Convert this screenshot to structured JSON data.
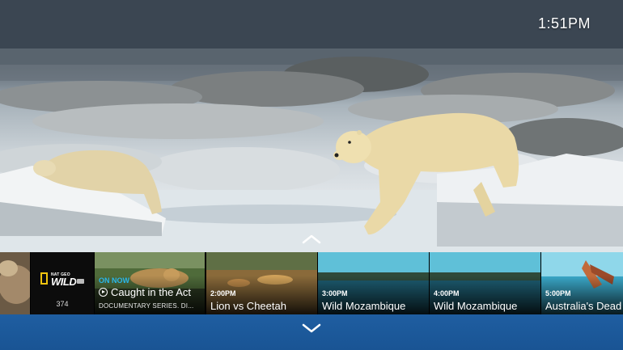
{
  "clock": "1:51PM",
  "channel": {
    "logo_top": "NAT GEO",
    "logo_main": "WILD",
    "logo_badge": "HD",
    "number": "374"
  },
  "current_program": {
    "status": "ON NOW",
    "title": "Caught in the Act",
    "description": "DOCUMENTARY SERIES. DI..."
  },
  "upcoming": [
    {
      "time": "2:00PM",
      "title": "Lion vs Cheetah"
    },
    {
      "time": "3:00PM",
      "title": "Wild Mozambique"
    },
    {
      "time": "4:00PM",
      "title": "Wild Mozambique"
    },
    {
      "time": "5:00PM",
      "title": "Australia's Dead"
    }
  ],
  "colors": {
    "accent": "#29b7ea",
    "footer": "#1f5ea1"
  },
  "icons": {
    "up": "chevron-up-icon",
    "down": "chevron-down-icon",
    "play": "play-circle-icon"
  }
}
